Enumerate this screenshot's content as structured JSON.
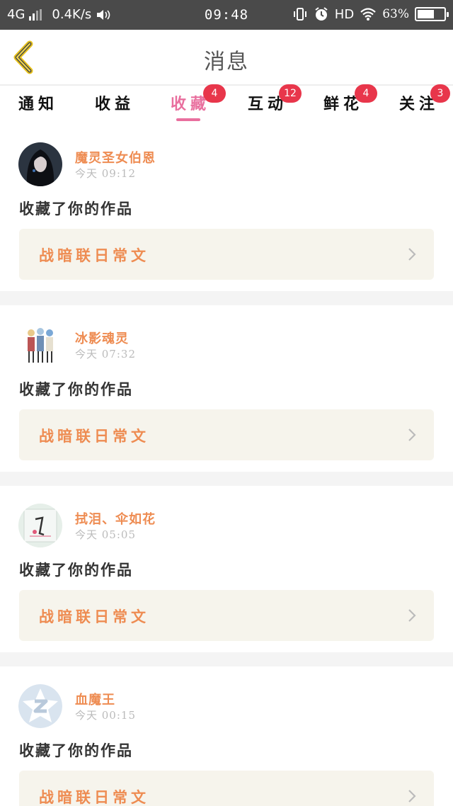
{
  "status_bar": {
    "network": "4G",
    "speed": "0.4K/s",
    "time": "09:48",
    "hd": "HD",
    "battery": "63%",
    "battery_level": 0.63
  },
  "header": {
    "title": "消息"
  },
  "tabs": [
    {
      "label": "通知",
      "badge": ""
    },
    {
      "label": "收益",
      "badge": ""
    },
    {
      "label": "收藏",
      "badge": "4",
      "active": true
    },
    {
      "label": "互动",
      "badge": "12"
    },
    {
      "label": "鲜花",
      "badge": "4"
    },
    {
      "label": "关注",
      "badge": "3"
    }
  ],
  "messages": [
    {
      "user": "魔灵圣女伯恩",
      "time": "今天 09:12",
      "action": "收藏了你的作品",
      "work": "战暗联日常文",
      "avatar": "anime-girl-avatar"
    },
    {
      "user": "冰影魂灵",
      "time": "今天 07:32",
      "action": "收藏了你的作品",
      "work": "战暗联日常文",
      "avatar": "group-girls-avatar"
    },
    {
      "user": "拭泪、伞如花",
      "time": "今天 05:05",
      "action": "收藏了你的作品",
      "work": "战暗联日常文",
      "avatar": "sketch-avatar"
    },
    {
      "user": "血魔王",
      "time": "今天 00:15",
      "action": "收藏了你的作品",
      "work": "战暗联日常文",
      "avatar": "default-qq-avatar"
    }
  ]
}
